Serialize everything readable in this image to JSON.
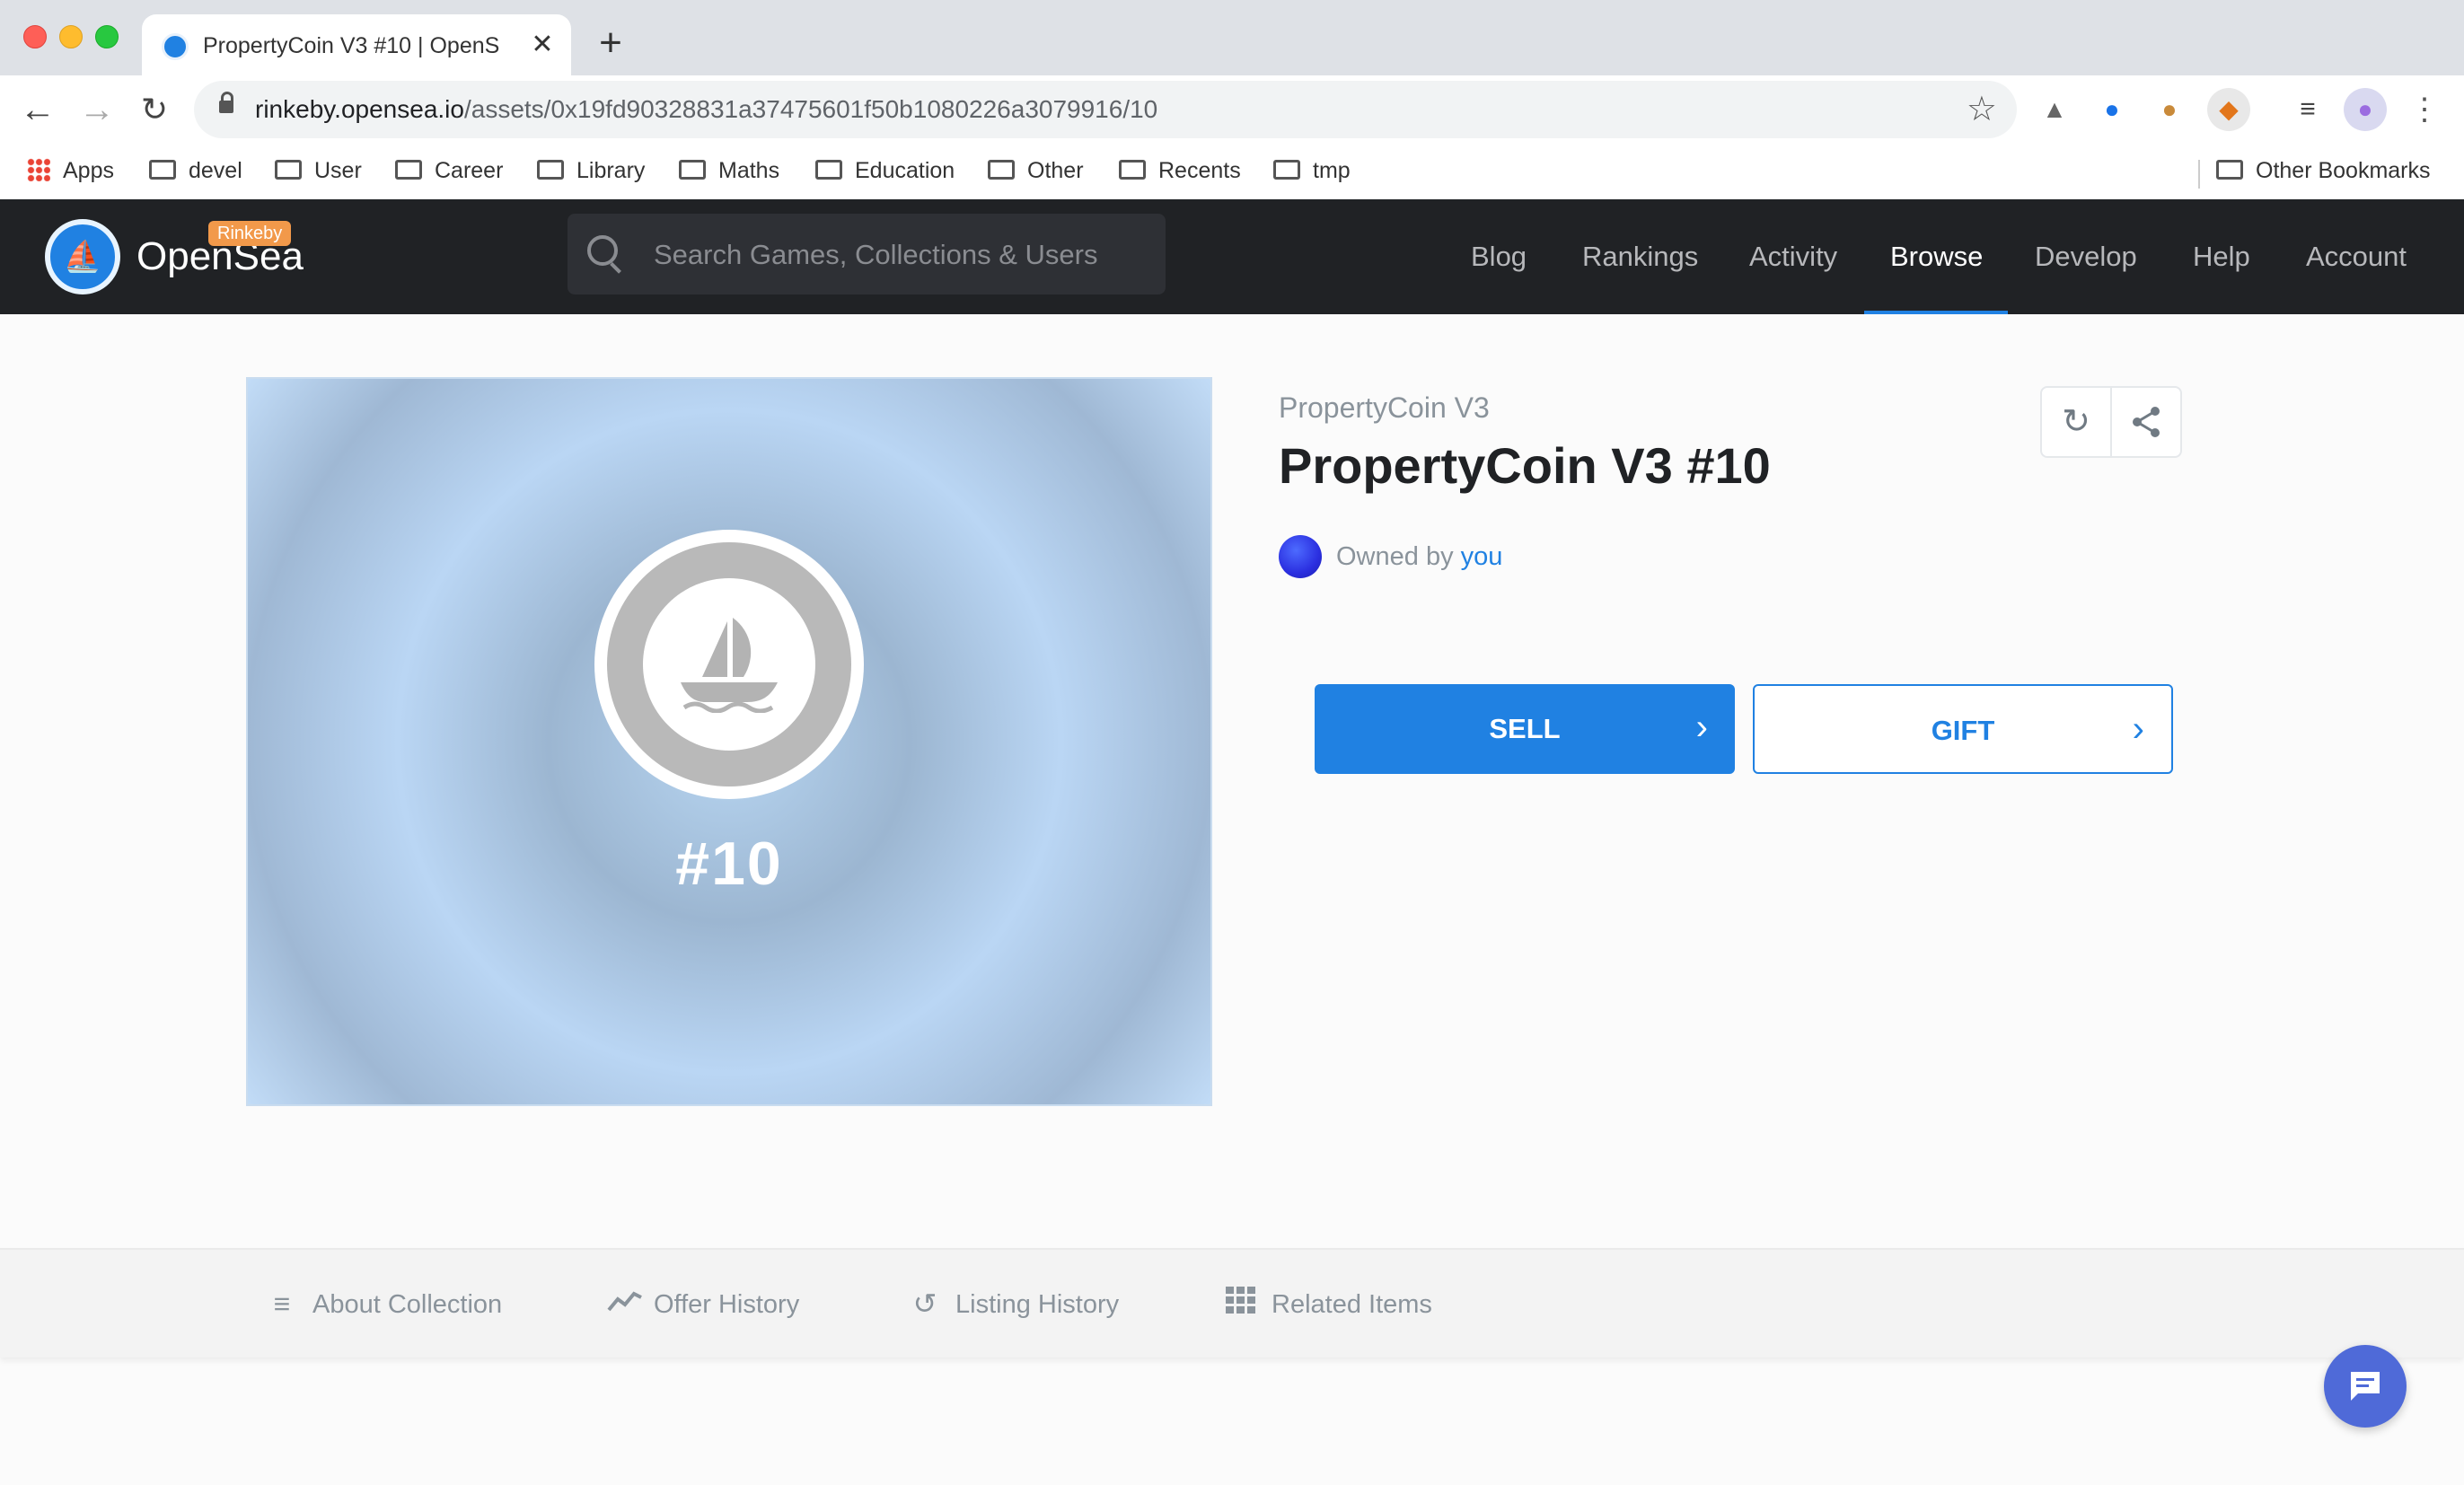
{
  "browser": {
    "tab_title": "PropertyCoin V3 #10 | OpenSea",
    "tab_close": "✕",
    "new_tab": "+",
    "url_host": "rinkeby.opensea.io",
    "url_path": "/assets/0x19fd90328831a37475601f50b1080226a3079916/10",
    "bookmarks": [
      {
        "label": "Apps"
      },
      {
        "label": "devel"
      },
      {
        "label": "User"
      },
      {
        "label": "Career"
      },
      {
        "label": "Library"
      },
      {
        "label": "Maths"
      },
      {
        "label": "Education"
      },
      {
        "label": "Other"
      },
      {
        "label": "Recents"
      },
      {
        "label": "tmp"
      }
    ],
    "other_bookmarks": "Other Bookmarks"
  },
  "header": {
    "logo_text": "OpenSea",
    "network_badge": "Rinkeby",
    "search_placeholder": "Search Games, Collections & Users",
    "nav": [
      "Blog",
      "Rankings",
      "Activity",
      "Browse",
      "Develop",
      "Help",
      "Account"
    ],
    "active_nav": "Browse",
    "accent_color": "#2081e2"
  },
  "asset": {
    "collection": "PropertyCoin V3",
    "title": "PropertyCoin V3 #10",
    "token_number": "#10",
    "owned_by_label": "Owned by",
    "owner": "you",
    "sell_label": "SELL",
    "gift_label": "GIFT"
  },
  "tabs": [
    {
      "label": "About Collection",
      "icon": "list-icon"
    },
    {
      "label": "Offer History",
      "icon": "trend-icon"
    },
    {
      "label": "Listing History",
      "icon": "history-icon"
    },
    {
      "label": "Related Items",
      "icon": "grid-icon"
    }
  ]
}
